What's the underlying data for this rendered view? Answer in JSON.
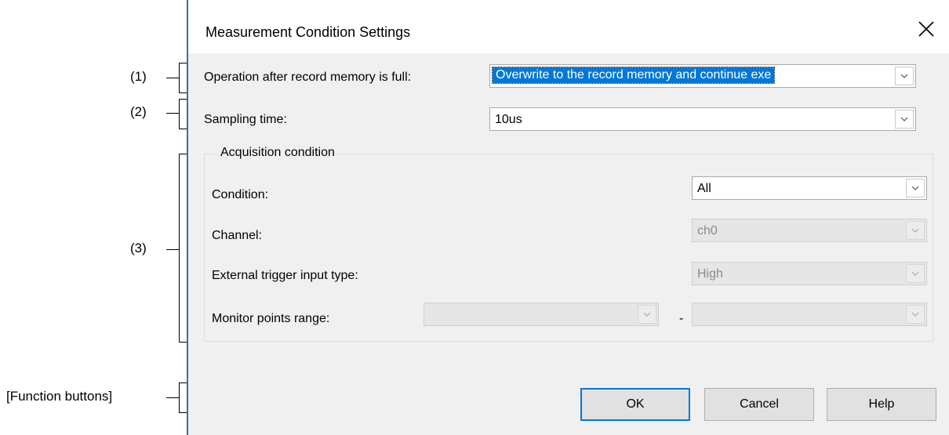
{
  "callouts": {
    "c1": "(1)",
    "c2": "(2)",
    "c3": "(3)",
    "fb": "[Function buttons]"
  },
  "dialog": {
    "title": "Measurement Condition Settings",
    "close_glyph": "✕"
  },
  "fields": {
    "operation_label": "Operation after record memory is full:",
    "operation_value": "Overwrite to the record memory and continue exe",
    "sampling_label": "Sampling time:",
    "sampling_value": "10us"
  },
  "acquisition": {
    "group_title": "Acquisition condition",
    "condition_label": "Condition:",
    "condition_value": "All",
    "channel_label": "Channel:",
    "channel_value": "ch0",
    "trigger_label": "External trigger input type:",
    "trigger_value": "High",
    "monitor_label": "Monitor points range:",
    "monitor_from": "",
    "monitor_to": "",
    "range_separator": "-"
  },
  "buttons": {
    "ok": "OK",
    "cancel": "Cancel",
    "help": "Help"
  },
  "icons": {
    "close": "close-icon",
    "dropdown": "chevron-down-icon"
  },
  "colors": {
    "accent": "#0078d7",
    "dialog_bg": "#f0f0f0"
  }
}
